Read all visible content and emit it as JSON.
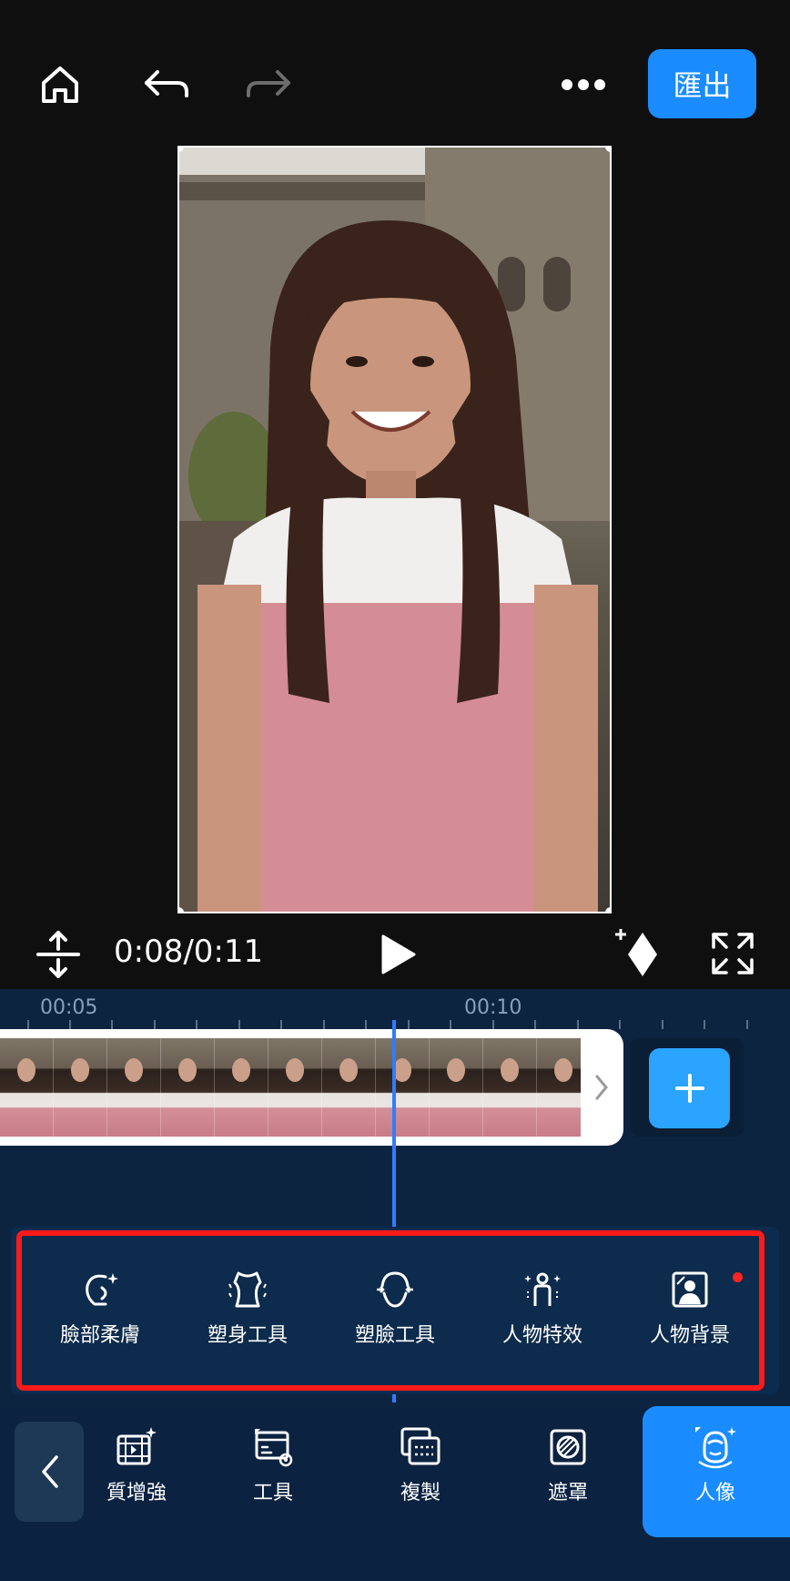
{
  "header": {
    "export_label": "匯出"
  },
  "player": {
    "time": "0:08/0:11"
  },
  "timeline": {
    "ruler_labels": [
      "00:05",
      "00:10"
    ]
  },
  "portrait_tools": [
    {
      "label": "臉部柔膚",
      "icon": "face-smooth-icon"
    },
    {
      "label": "塑身工具",
      "icon": "body-shape-icon"
    },
    {
      "label": "塑臉工具",
      "icon": "face-shape-icon"
    },
    {
      "label": "人物特效",
      "icon": "person-effect-icon"
    },
    {
      "label": "人物背景",
      "icon": "person-background-icon"
    }
  ],
  "bottom_toolbar": [
    {
      "label": "質增強",
      "icon": "enhance-icon"
    },
    {
      "label": "工具",
      "icon": "tools-icon"
    },
    {
      "label": "複製",
      "icon": "copy-icon"
    },
    {
      "label": "遮罩",
      "icon": "mask-icon"
    },
    {
      "label": "人像",
      "icon": "portrait-icon",
      "active": true
    }
  ],
  "colors": {
    "accent": "#1a8cff",
    "highlight": "#ff1a1a",
    "panel": "#0d2b4c"
  }
}
